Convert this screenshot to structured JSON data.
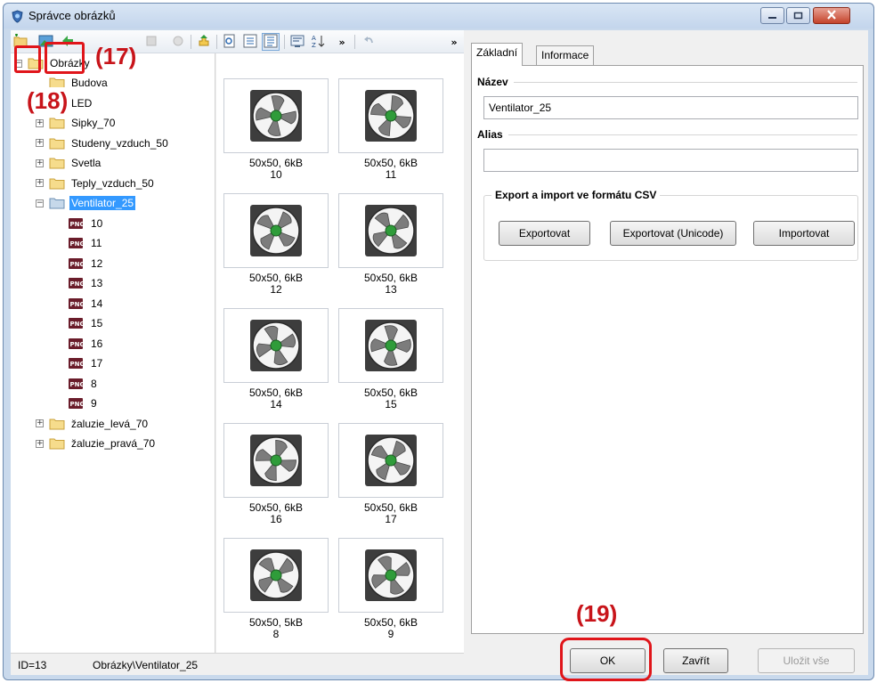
{
  "window": {
    "title": "Správce obrázků",
    "icon": "app-shield-icon",
    "controls": [
      "minimize-icon",
      "maximize-icon",
      "close-icon"
    ]
  },
  "toolbar": {
    "icons": [
      "new-folder-icon",
      "add-image-icon",
      "import-icon",
      "disabled-icon",
      "disabled-icon",
      "upload-icon",
      "preview-icon",
      "list-view-icon",
      "detail-view-icon",
      "properties-icon",
      "sort-az-icon",
      "overflow-icon",
      "undo-icon",
      "overflow-icon"
    ]
  },
  "callouts": {
    "c17": "(17)",
    "c18": "(18)",
    "c19": "(19)",
    "color": "#e0151a"
  },
  "tree": {
    "root": "Obrázky",
    "folders": [
      "Budova",
      "LED",
      "Sipky_70",
      "Studeny_vzduch_50",
      "Svetla",
      "Teply_vzduch_50",
      "Ventilator_25"
    ],
    "selected_folder": "Ventilator_25",
    "files": [
      "10",
      "11",
      "12",
      "13",
      "14",
      "15",
      "16",
      "17",
      "8",
      "9"
    ],
    "folders_after": [
      "žaluzie_levá_70",
      "žaluzie_pravá_70"
    ],
    "selection_color": "#3399ff"
  },
  "gallery": {
    "items": [
      {
        "info": "50x50, 6kB",
        "name": "10"
      },
      {
        "info": "50x50, 6kB",
        "name": "11"
      },
      {
        "info": "50x50, 6kB",
        "name": "12"
      },
      {
        "info": "50x50, 6kB",
        "name": "13"
      },
      {
        "info": "50x50, 6kB",
        "name": "14"
      },
      {
        "info": "50x50, 6kB",
        "name": "15"
      },
      {
        "info": "50x50, 6kB",
        "name": "16"
      },
      {
        "info": "50x50, 6kB",
        "name": "17"
      },
      {
        "info": "50x50, 5kB",
        "name": "8"
      },
      {
        "info": "50x50, 6kB",
        "name": "9"
      }
    ]
  },
  "tabs": {
    "basic": "Základní",
    "info": "Informace"
  },
  "form": {
    "name_label": "Název",
    "name_value": "Ventilator_25",
    "alias_label": "Alias",
    "alias_value": "",
    "csv_group_title": "Export a import ve formátu CSV",
    "export_button": "Exportovat",
    "export_unicode_button": "Exportovat (Unicode)",
    "import_button": "Importovat"
  },
  "footer": {
    "ok_button": "OK",
    "close_button": "Zavřít",
    "save_all_button": "Uložit vše"
  },
  "status": {
    "id": "ID=13",
    "path": "Obrázky\\Ventilator_25"
  }
}
